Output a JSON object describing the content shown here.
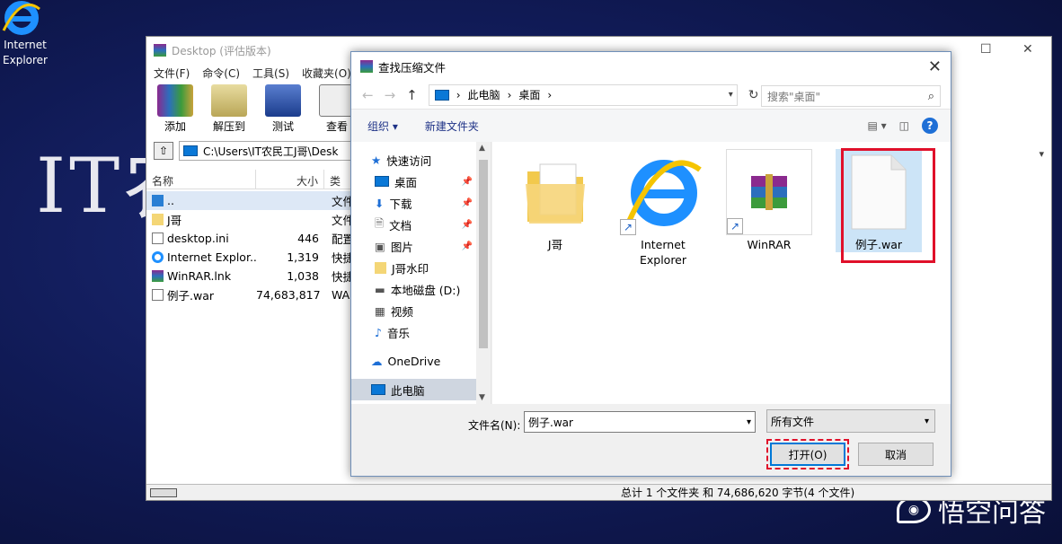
{
  "desktop": {
    "background_text": "IT农",
    "icon_label_line1": "Internet",
    "icon_label_line2": "Explorer",
    "watermark": "悟空问答"
  },
  "winrar": {
    "title": "Desktop (评估版本)",
    "menu": [
      "文件(F)",
      "命令(C)",
      "工具(S)",
      "收藏夹(O)"
    ],
    "toolbar": [
      "添加",
      "解压到",
      "测试",
      "查看"
    ],
    "path": "C:\\Users\\IT农民工J哥\\Desk",
    "columns": {
      "name": "名称",
      "size": "大小",
      "type": "类型"
    },
    "rows": [
      {
        "name": "..",
        "size": "",
        "type": "文件"
      },
      {
        "name": "J哥",
        "size": "",
        "type": "文件"
      },
      {
        "name": "desktop.ini",
        "size": "446",
        "type": "配置"
      },
      {
        "name": "Internet Explor...",
        "size": "1,319",
        "type": "快捷"
      },
      {
        "name": "WinRAR.lnk",
        "size": "1,038",
        "type": "快捷"
      },
      {
        "name": "例子.war",
        "size": "74,683,817",
        "type": "WA"
      }
    ],
    "status": "总计 1 个文件夹 和 74,686,620 字节(4 个文件)"
  },
  "dialog": {
    "title": "查找压缩文件",
    "breadcrumb": [
      "此电脑",
      "桌面"
    ],
    "search_placeholder": "搜索\"桌面\"",
    "organize": "组织 ▾",
    "new_folder": "新建文件夹",
    "nav": [
      {
        "label": "快速访问",
        "icon": "star-icon",
        "pinned": false
      },
      {
        "label": "桌面",
        "icon": "desktop-icon",
        "pinned": true
      },
      {
        "label": "下载",
        "icon": "download-icon",
        "pinned": true
      },
      {
        "label": "文档",
        "icon": "document-icon",
        "pinned": true
      },
      {
        "label": "图片",
        "icon": "picture-icon",
        "pinned": true
      },
      {
        "label": "J哥水印",
        "icon": "folder-icon",
        "pinned": false
      },
      {
        "label": "本地磁盘 (D:)",
        "icon": "drive-icon",
        "pinned": false
      },
      {
        "label": "视频",
        "icon": "video-icon",
        "pinned": false
      },
      {
        "label": "音乐",
        "icon": "music-icon",
        "pinned": false
      },
      {
        "label": "OneDrive",
        "icon": "cloud-icon",
        "pinned": false
      },
      {
        "label": "此电脑",
        "icon": "computer-icon",
        "pinned": false
      }
    ],
    "files": [
      {
        "name": "J哥",
        "name2": "",
        "icon": "folder-icon"
      },
      {
        "name": "Internet",
        "name2": "Explorer",
        "icon": "ie-icon"
      },
      {
        "name": "WinRAR",
        "name2": "",
        "icon": "winrar-icon"
      },
      {
        "name": "例子.war",
        "name2": "",
        "icon": "blank-file-icon"
      }
    ],
    "filename_label": "文件名(N):",
    "filename_value": "例子.war",
    "filetype": "所有文件",
    "open_label": "打开(O)",
    "cancel_label": "取消"
  }
}
